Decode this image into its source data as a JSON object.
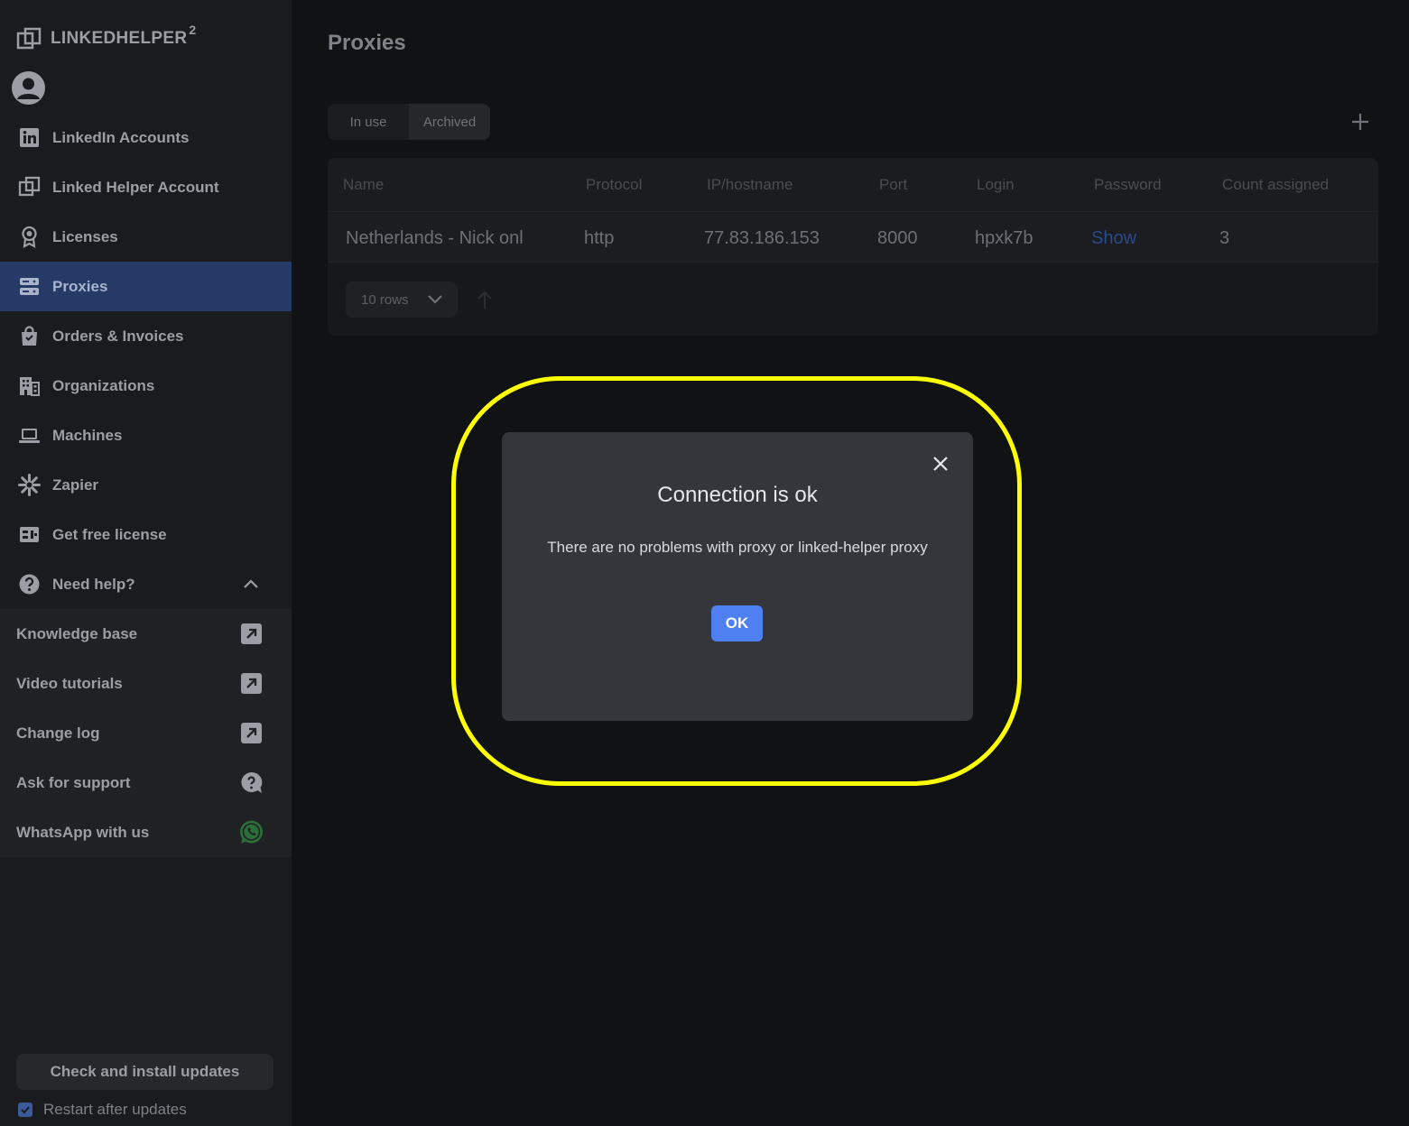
{
  "brand": {
    "name": "LINKEDHELPER",
    "superscript": "2"
  },
  "sidebar": {
    "items": [
      {
        "label": "LinkedIn Accounts",
        "icon": "linkedin-icon"
      },
      {
        "label": "Linked Helper Account",
        "icon": "linkedhelper-logo-icon"
      },
      {
        "label": "Licenses",
        "icon": "award-icon"
      },
      {
        "label": "Proxies",
        "icon": "server-icon",
        "active": true
      },
      {
        "label": "Orders & Invoices",
        "icon": "shopping-bag-icon"
      },
      {
        "label": "Organizations",
        "icon": "building-icon"
      },
      {
        "label": "Machines",
        "icon": "laptop-icon"
      },
      {
        "label": "Zapier",
        "icon": "zapier-icon"
      },
      {
        "label": "Get free license",
        "icon": "gift-license-icon"
      },
      {
        "label": "Need help?",
        "icon": "question-circle-icon"
      }
    ],
    "help_items": [
      {
        "label": "Knowledge base",
        "icon": "external-link-icon"
      },
      {
        "label": "Video tutorials",
        "icon": "external-link-icon"
      },
      {
        "label": "Change log",
        "icon": "external-link-icon"
      },
      {
        "label": "Ask for support",
        "icon": "question-bubble-icon"
      },
      {
        "label": "WhatsApp with us",
        "icon": "whatsapp-icon"
      }
    ],
    "update_button": "Check and install updates",
    "restart_label": "Restart after updates"
  },
  "main": {
    "title": "Proxies",
    "tabs": [
      {
        "label": "In use"
      },
      {
        "label": "Archived"
      }
    ],
    "table": {
      "columns": [
        "Name",
        "Protocol",
        "IP/hostname",
        "Port",
        "Login",
        "Password",
        "Count assigned"
      ],
      "rows": [
        {
          "name": "Netherlands - Nick onl",
          "protocol": "http",
          "ip": "77.83.186.153",
          "port": "8000",
          "login": "hpxk7b",
          "password": "Show",
          "count": "3"
        }
      ]
    },
    "rows_per_page": "10 rows"
  },
  "modal": {
    "title": "Connection is ok",
    "message": "There are no problems with proxy or linked-helper proxy",
    "ok_label": "OK"
  },
  "colors": {
    "accent": "#4f80f2",
    "active_nav": "#253a66",
    "highlight": "#ffff00",
    "whatsapp": "#2b6e3a"
  }
}
